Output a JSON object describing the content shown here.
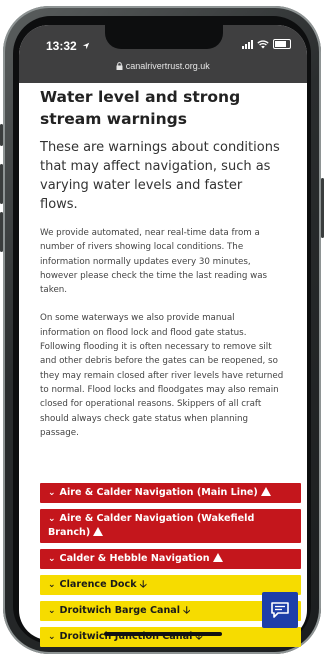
{
  "status_bar": {
    "time": "13:32",
    "url": "canalrivertrust.org.uk"
  },
  "page": {
    "heading": "Water level and strong stream warnings",
    "lead": "These are warnings about conditions that may affect navigation, such as varying water levels and faster flows.",
    "paragraph_1": "We provide automated, near real-time data from a number of rivers showing local conditions.  The information normally updates every 30 minutes, however please check the time the last reading was taken.",
    "paragraph_2": "On some waterways we also provide manual information on flood lock and flood gate status. Following flooding it is often necessary to remove silt and other debris before the gates can be reopened, so they may remain closed after river levels have returned to normal. Flood locks and floodgates may also remain closed for operational reasons. Skippers of all craft should always check gate status when planning passage."
  },
  "accordion": [
    {
      "label": "Aire & Calder Navigation (Main Line)",
      "status": "warning",
      "color": "#c4161c"
    },
    {
      "label": "Aire & Calder Navigation (Wakefield Branch)",
      "status": "warning",
      "color": "#c4161c"
    },
    {
      "label": "Calder & Hebble Navigation",
      "status": "warning",
      "color": "#c4161c"
    },
    {
      "label": "Clarence Dock",
      "status": "falling",
      "color": "#f6dc00"
    },
    {
      "label": "Droitwich Barge Canal",
      "status": "falling",
      "color": "#f6dc00"
    },
    {
      "label": "Droitwich Junction Canal",
      "status": "falling",
      "color": "#f6dc00"
    }
  ],
  "icons": {
    "chevron": "chevron-down-icon",
    "warning": "warning-triangle-icon",
    "falling": "arrow-down-icon",
    "chat": "chat-icon"
  }
}
